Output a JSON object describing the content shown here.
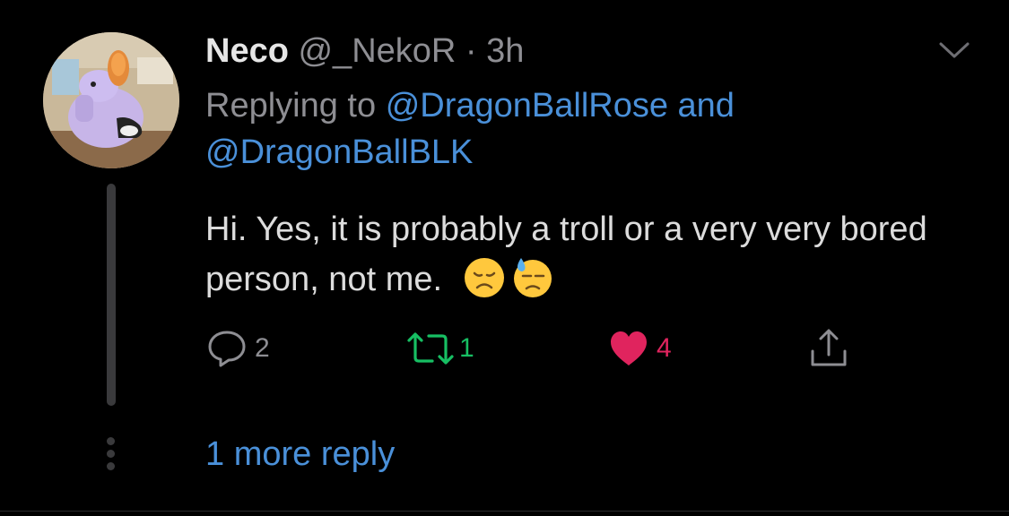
{
  "tweet": {
    "display_name": "Neco",
    "handle": "@_NekoR",
    "separator": "·",
    "time": "3h",
    "replying_prefix": "Replying to",
    "mention_1": "@DragonBallRose",
    "conjunction": "and",
    "mention_2": "@DragonBallBLK",
    "text": "Hi. Yes, it is probably a troll or a very very bored person, not me.",
    "emojis": [
      "disappointed-face-emoji",
      "downcast-face-with-sweat-emoji"
    ]
  },
  "actions": {
    "reply_count": "2",
    "retweet_count": "1",
    "like_count": "4",
    "liked": true
  },
  "more_replies_label": "1 more reply",
  "colors": {
    "background": "#000000",
    "link": "#4a90d9",
    "secondary_text": "#8e8e93",
    "retweet": "#17bf63",
    "like": "#e0245e"
  }
}
